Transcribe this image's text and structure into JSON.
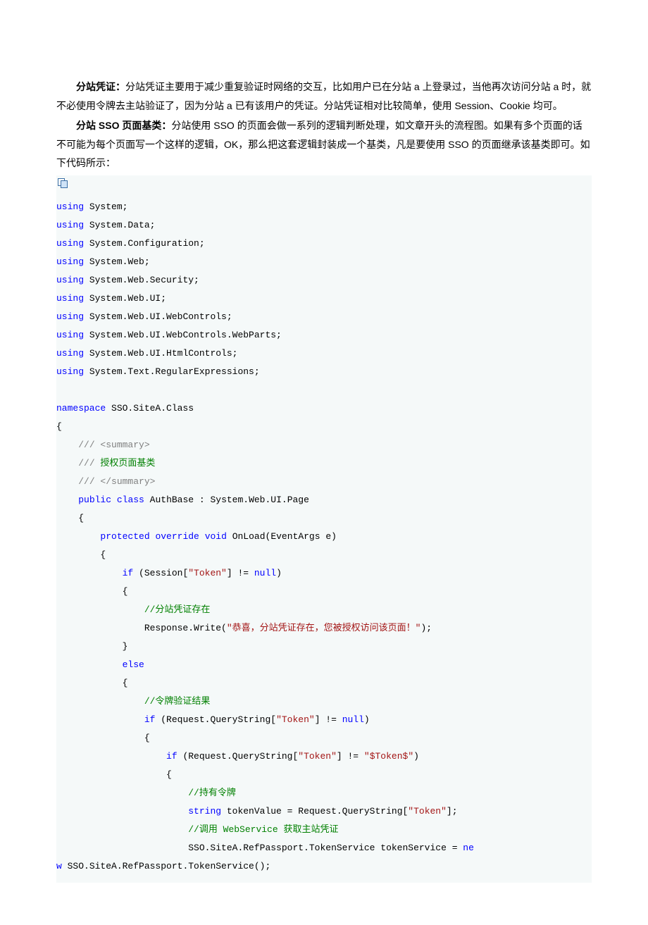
{
  "paras": [
    {
      "bold": "分站凭证：",
      "text": "分站凭证主要用于减少重复验证时网络的交互，比如用户已在分站 a 上登录过，当他再次访问分站 a 时，就不必使用令牌去主站验证了，因为分站 a 已有该用户的凭证。分站凭证相对比较简单，使用 Session、Cookie 均可。"
    },
    {
      "bold": "分站 SSO 页面基类：",
      "text": "分站使用 SSO 的页面会做一系列的逻辑判断处理，如文章开头的流程图。如果有多个页面的话不可能为每个页面写一个这样的逻辑，OK，那么把这套逻辑封装成一个基类，凡是要使用 SSO 的页面继承该基类即可。如下代码所示："
    }
  ],
  "code": [
    [
      [
        "k-blue",
        "using"
      ],
      [
        "k-black",
        " System;"
      ]
    ],
    [
      [
        "k-blue",
        "using"
      ],
      [
        "k-black",
        " System.Data;"
      ]
    ],
    [
      [
        "k-blue",
        "using"
      ],
      [
        "k-black",
        " System.Configuration;"
      ]
    ],
    [
      [
        "k-blue",
        "using"
      ],
      [
        "k-black",
        " System.Web;"
      ]
    ],
    [
      [
        "k-blue",
        "using"
      ],
      [
        "k-black",
        " System.Web.Security;"
      ]
    ],
    [
      [
        "k-blue",
        "using"
      ],
      [
        "k-black",
        " System.Web.UI;"
      ]
    ],
    [
      [
        "k-blue",
        "using"
      ],
      [
        "k-black",
        " System.Web.UI.WebControls;"
      ]
    ],
    [
      [
        "k-blue",
        "using"
      ],
      [
        "k-black",
        " System.Web.UI.WebControls.WebParts;"
      ]
    ],
    [
      [
        "k-blue",
        "using"
      ],
      [
        "k-black",
        " System.Web.UI.HtmlControls;"
      ]
    ],
    [
      [
        "k-blue",
        "using"
      ],
      [
        "k-black",
        " System.Text.RegularExpressions;"
      ]
    ],
    [],
    [
      [
        "k-blue",
        "namespace"
      ],
      [
        "k-black",
        " SSO.SiteA.Class"
      ]
    ],
    [
      [
        "k-black",
        "{"
      ]
    ],
    [
      [
        "k-black",
        "    "
      ],
      [
        "k-gray",
        "/// <summary>"
      ]
    ],
    [
      [
        "k-black",
        "    "
      ],
      [
        "k-gray",
        "///"
      ],
      [
        "k-green",
        " 授权页面基类"
      ]
    ],
    [
      [
        "k-black",
        "    "
      ],
      [
        "k-gray",
        "/// </summary>"
      ]
    ],
    [
      [
        "k-black",
        "    "
      ],
      [
        "k-blue",
        "public"
      ],
      [
        "k-black",
        " "
      ],
      [
        "k-blue",
        "class"
      ],
      [
        "k-black",
        " AuthBase : System.Web.UI.Page"
      ]
    ],
    [
      [
        "k-black",
        "    {"
      ]
    ],
    [
      [
        "k-black",
        "        "
      ],
      [
        "k-blue",
        "protected"
      ],
      [
        "k-black",
        " "
      ],
      [
        "k-blue",
        "override"
      ],
      [
        "k-black",
        " "
      ],
      [
        "k-blue",
        "void"
      ],
      [
        "k-black",
        " OnLoad(EventArgs e)"
      ]
    ],
    [
      [
        "k-black",
        "        {"
      ]
    ],
    [
      [
        "k-black",
        "            "
      ],
      [
        "k-blue",
        "if"
      ],
      [
        "k-black",
        " (Session["
      ],
      [
        "k-red",
        "\"Token\""
      ],
      [
        "k-black",
        "] != "
      ],
      [
        "k-blue",
        "null"
      ],
      [
        "k-black",
        ")"
      ]
    ],
    [
      [
        "k-black",
        "            {"
      ]
    ],
    [
      [
        "k-black",
        "                "
      ],
      [
        "k-green",
        "//分站凭证存在"
      ]
    ],
    [
      [
        "k-black",
        "                Response.Write("
      ],
      [
        "k-red",
        "\"恭喜，分站凭证存在，您被授权访问该页面！\""
      ],
      [
        "k-black",
        ");"
      ]
    ],
    [
      [
        "k-black",
        "            }"
      ]
    ],
    [
      [
        "k-black",
        "            "
      ],
      [
        "k-blue",
        "else"
      ]
    ],
    [
      [
        "k-black",
        "            {"
      ]
    ],
    [
      [
        "k-black",
        "                "
      ],
      [
        "k-green",
        "//令牌验证结果"
      ]
    ],
    [
      [
        "k-black",
        "                "
      ],
      [
        "k-blue",
        "if"
      ],
      [
        "k-black",
        " (Request.QueryString["
      ],
      [
        "k-red",
        "\"Token\""
      ],
      [
        "k-black",
        "] != "
      ],
      [
        "k-blue",
        "null"
      ],
      [
        "k-black",
        ")"
      ]
    ],
    [
      [
        "k-black",
        "                {"
      ]
    ],
    [
      [
        "k-black",
        "                    "
      ],
      [
        "k-blue",
        "if"
      ],
      [
        "k-black",
        " (Request.QueryString["
      ],
      [
        "k-red",
        "\"Token\""
      ],
      [
        "k-black",
        "] != "
      ],
      [
        "k-red",
        "\"$Token$\""
      ],
      [
        "k-black",
        ")"
      ]
    ],
    [
      [
        "k-black",
        "                    {"
      ]
    ],
    [
      [
        "k-black",
        "                        "
      ],
      [
        "k-green",
        "//持有令牌"
      ]
    ],
    [
      [
        "k-black",
        "                        "
      ],
      [
        "k-blue",
        "string"
      ],
      [
        "k-black",
        " tokenValue = Request.QueryString["
      ],
      [
        "k-red",
        "\"Token\""
      ],
      [
        "k-black",
        "];"
      ]
    ],
    [
      [
        "k-black",
        "                        "
      ],
      [
        "k-green",
        "//调用 WebService 获取主站凭证"
      ]
    ],
    [
      [
        "k-black",
        "                        SSO.SiteA.RefPassport.TokenService tokenService = "
      ],
      [
        "k-blue",
        "ne"
      ]
    ],
    [
      [
        "k-blue",
        "w"
      ],
      [
        "k-black",
        " SSO.SiteA.RefPassport.TokenService();"
      ]
    ]
  ]
}
